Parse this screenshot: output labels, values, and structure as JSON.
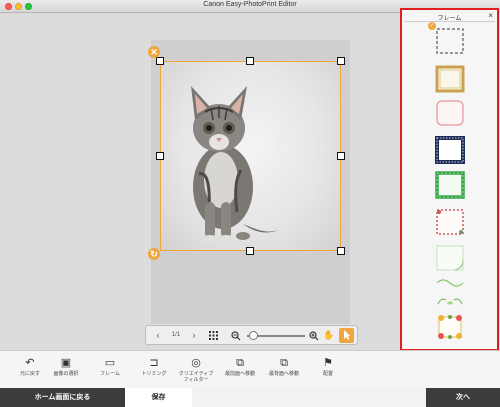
{
  "window": {
    "title": "Canon Easy-PhotoPrint Editor"
  },
  "page_nav": {
    "prev": "‹",
    "page_indicator": "1/1",
    "next": "›"
  },
  "panel": {
    "title": "フレーム",
    "close": "×",
    "frames": [
      {
        "name": "none-dashed",
        "selected": true
      },
      {
        "name": "gold-square"
      },
      {
        "name": "pink-rounded"
      },
      {
        "name": "navy-pattern"
      },
      {
        "name": "green-leaf"
      },
      {
        "name": "red-floral"
      },
      {
        "name": "light-green-corner"
      },
      {
        "name": "green-vine"
      },
      {
        "name": "green-leaves-corner"
      },
      {
        "name": "flower-bouquet"
      }
    ]
  },
  "toolbar": {
    "undo": "元に戻す",
    "image_select": "画像の選択",
    "frame": "フレーム",
    "trim": "トリミング",
    "creative_filter_1": "クリエイティブ",
    "creative_filter_2": "フィルター",
    "bring_front": "最前面へ移動",
    "send_back": "最背面へ移動",
    "arrange": "配置"
  },
  "footer": {
    "home": "ホーム画面に戻る",
    "save": "保存",
    "next": "次へ"
  },
  "colors": {
    "accent": "#f0a640",
    "highlight": "#e02020"
  }
}
